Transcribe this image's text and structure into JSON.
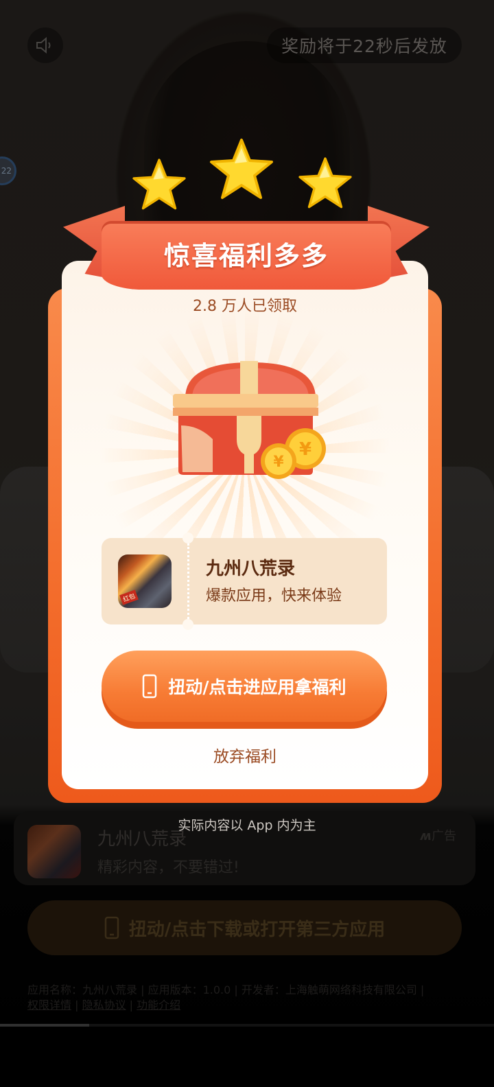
{
  "background": {
    "reward_timer_text": "奖励将于22秒后发放",
    "side_badge_text": "22",
    "ad_card": {
      "app_name": "九州八荒录",
      "description": "精彩内容，不要错过!",
      "ad_label": "广告",
      "icon": "app-icon-game"
    },
    "download_button_label": "扭动/点击下载或打开第三方应用",
    "footer": {
      "info_line": "应用名称：九州八荒录 | 应用版本：1.0.0 | 开发者：上海触萌网络科技有限公司 |",
      "permission_link": "权限详情",
      "privacy_link": "隐私协议",
      "feature_link": "功能介绍",
      "separator": " | "
    },
    "video_progress": 0.18
  },
  "popup": {
    "ribbon_title": "惊喜福利多多",
    "claimed_count": "2.8 万人已领取",
    "treasure_icon": "treasure-chest-icon",
    "app_card": {
      "app_name": "九州八荒录",
      "subtitle": "爆款应用，快来体验",
      "icon_tag": "红包"
    },
    "cta_label": "扭动/点击进应用拿福利",
    "give_up_label": "放弃福利",
    "disclaimer": "实际内容以 App 内为主"
  },
  "colors": {
    "accent_orange": "#f77b34",
    "ribbon_red": "#f0593a",
    "card_beige": "#f7e3cb",
    "text_brown": "#9a4a22"
  }
}
